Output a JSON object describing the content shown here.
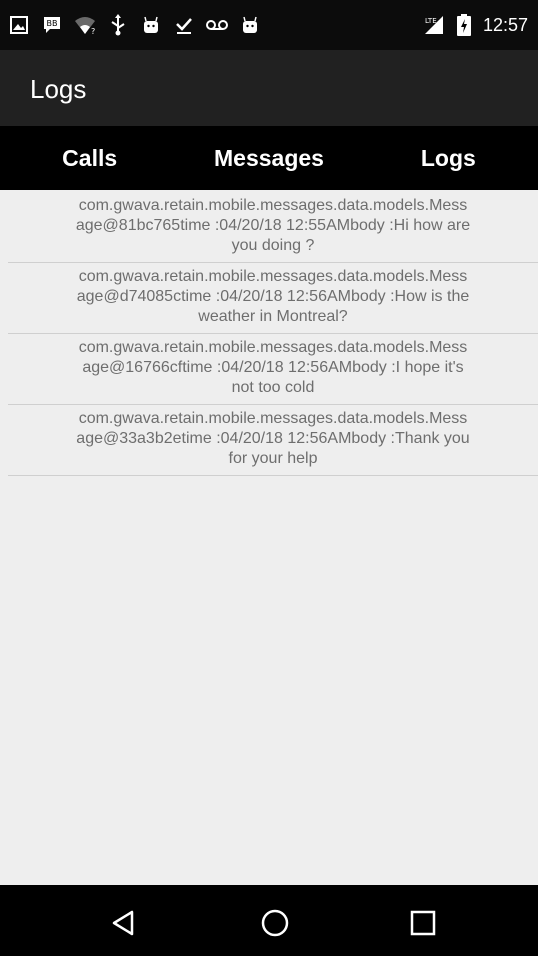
{
  "status_bar": {
    "icons": [
      "gallery-icon",
      "bbm-icon",
      "wifi-icon",
      "usb-icon",
      "android-icon",
      "download-done-icon",
      "voicemail-icon",
      "android-icon",
      "signal-icon",
      "battery-icon"
    ],
    "time": "12:57"
  },
  "app_bar": {
    "title": "Logs"
  },
  "tabs": [
    {
      "label": "Calls"
    },
    {
      "label": "Messages"
    },
    {
      "label": "Logs"
    }
  ],
  "logs": [
    {
      "text": "com.gwava.retain.mobile.messages.data.models.Mess\nage@81bc765time :04/20/18 12:55AMbody :Hi how are\nyou doing ?"
    },
    {
      "text": "com.gwava.retain.mobile.messages.data.models.Mess\nage@d74085ctime :04/20/18 12:56AMbody :How is the\nweather in Montreal?"
    },
    {
      "text": "com.gwava.retain.mobile.messages.data.models.Mess\nage@16766cftime :04/20/18 12:56AMbody :I hope it's\nnot too cold"
    },
    {
      "text": "com.gwava.retain.mobile.messages.data.models.Mess\nage@33a3b2etime :04/20/18 12:56AMbody :Thank you\nfor your help"
    }
  ],
  "nav_bar": {
    "icons": [
      "back-icon",
      "home-icon",
      "recents-icon"
    ]
  }
}
